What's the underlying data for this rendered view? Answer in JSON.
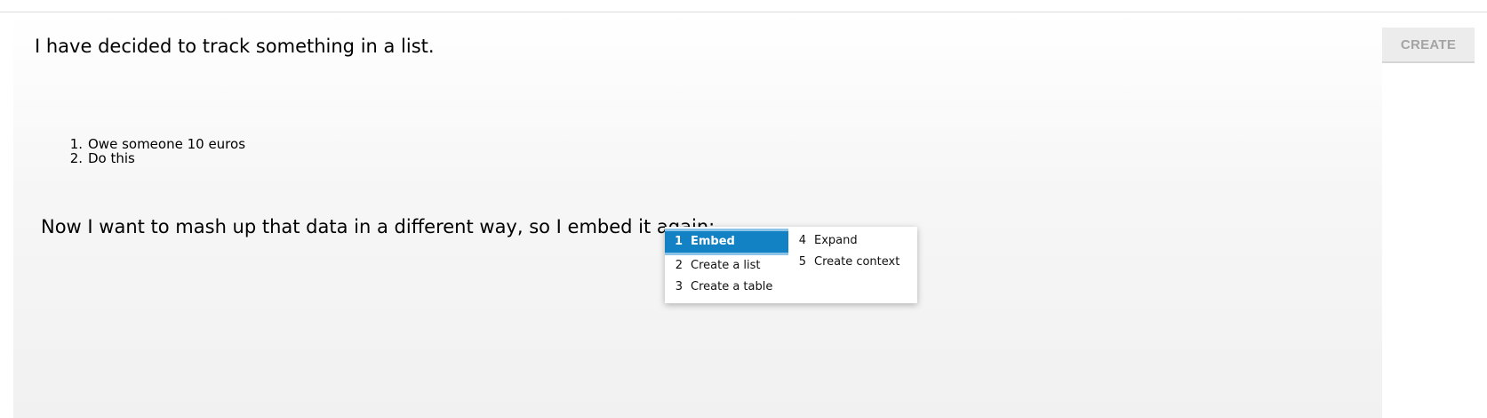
{
  "toolbar": {
    "create_label": "CREATE"
  },
  "document": {
    "paragraph1": "I have decided to track something in a list.",
    "list": [
      {
        "number": "1.",
        "text": "Owe someone 10 euros"
      },
      {
        "number": "2.",
        "text": "Do this"
      }
    ],
    "paragraph2": "Now I want to mash up that data in a different way, so I embed it again:"
  },
  "menu": {
    "items": [
      {
        "key": "1",
        "label": "Embed",
        "active": true
      },
      {
        "key": "2",
        "label": "Create a list",
        "active": false
      },
      {
        "key": "3",
        "label": "Create a table",
        "active": false
      },
      {
        "key": "4",
        "label": "Expand",
        "active": false
      },
      {
        "key": "5",
        "label": "Create context",
        "active": false
      }
    ]
  },
  "colors": {
    "accent": "#1382c5",
    "accent_light": "#8cc3e6",
    "button_bg": "#ececec",
    "button_text": "#a4a4a4"
  }
}
